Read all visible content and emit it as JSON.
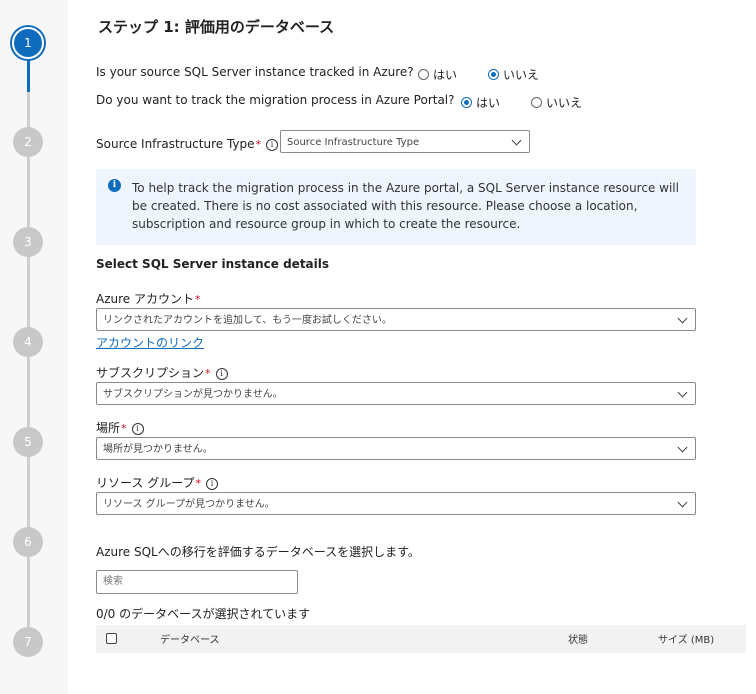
{
  "stepper": {
    "steps": [
      "1",
      "2",
      "3",
      "4",
      "5",
      "6",
      "7"
    ],
    "active_step": 1
  },
  "page": {
    "title": "ステップ 1: 評価用のデータベース"
  },
  "question_tracked": {
    "text": "Is your source SQL Server instance tracked in Azure?",
    "option_yes": "はい",
    "option_no": "いいえ",
    "selected": "いいえ"
  },
  "question_portal": {
    "text": "Do you want to track the migration process in Azure Portal?",
    "option_yes": "はい",
    "option_no": "いいえ",
    "selected": "はい"
  },
  "infrastructure": {
    "label": "Source Infrastructure Type",
    "required_mark": "*",
    "value": "Source Infrastructure Type"
  },
  "banner": {
    "icon": "info-icon",
    "text": "To help track the migration process in the Azure portal, a SQL Server instance resource will be created. There is no cost associated with this resource. Please choose a location, subscription and resource group in which to create the resource."
  },
  "instance_details": {
    "heading": "Select SQL Server instance details",
    "azure_account": {
      "label": "Azure アカウント",
      "required_mark": "*",
      "value": "リンクされたアカウントを追加して、もう一度お試しください。"
    },
    "link_account": "アカウントのリンク",
    "subscription": {
      "label": "サブスクリプション",
      "required_mark": "*",
      "value": "サブスクリプションが見つかりません。"
    },
    "location": {
      "label": "場所",
      "required_mark": "*",
      "value": "場所が見つかりません。"
    },
    "resource_group": {
      "label": "リソース グループ",
      "required_mark": "*",
      "value": "リソース グループが見つかりません。"
    }
  },
  "databases": {
    "instruction": "Azure SQLへの移行を評価するデータベースを選択します。",
    "search_placeholder": "検索",
    "selection_count": "0/0 のデータベースが選択されています",
    "columns": {
      "database": "データベース",
      "status": "状態",
      "size": "サイズ (MB)"
    }
  },
  "colors": {
    "accent": "#0f6cbd",
    "required": "#c50f1f",
    "banner_bg": "#eef5fc"
  }
}
